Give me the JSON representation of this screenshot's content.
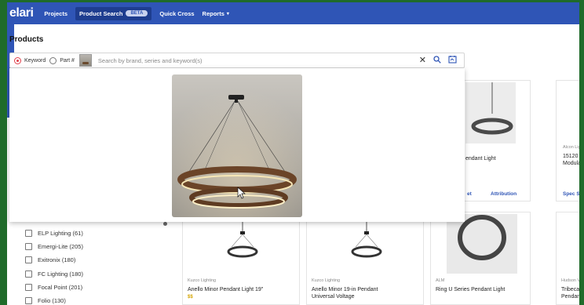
{
  "nav": {
    "logo": "elari",
    "items": [
      {
        "label": "Projects"
      },
      {
        "label": "Product Search",
        "badge": "BETA",
        "active": true
      },
      {
        "label": "Quick Cross"
      },
      {
        "label": "Reports",
        "caret": "▾"
      }
    ]
  },
  "page": {
    "title": "Products"
  },
  "search": {
    "mode_keyword": "Keyword",
    "mode_part": "Part #",
    "placeholder": "Search by brand, series and keyword(s)",
    "selected_mode": "Keyword"
  },
  "filters": [
    {
      "label": "ELP Lighting (61)"
    },
    {
      "label": "Emergi-Lite (205)"
    },
    {
      "label": "Exitronix (180)"
    },
    {
      "label": "FC Lighting (180)"
    },
    {
      "label": "Focal Point (201)"
    },
    {
      "label": "Folio (130)"
    }
  ],
  "top_cards": [
    {
      "name": "endant Light",
      "spec": "et",
      "attribution": "Attribution"
    },
    {
      "brand": "Alcon Lig",
      "name_line1": "15120 R",
      "name_line2": "Modular",
      "spec": "Spec S"
    }
  ],
  "products": [
    {
      "brand": "Kuzco Lighting",
      "name": "Anello Minor Pendant Light 19\"",
      "price": "$$"
    },
    {
      "brand": "Kuzco Lighting",
      "name_line1": "Anello Minor 19-in Pendant",
      "name_line2": "Universal Voltage"
    },
    {
      "brand": "ALM",
      "name": "Ring U Series Pendant Light"
    },
    {
      "brand": "Hudson V",
      "name_line1": "Tribeca",
      "name_line2": "Pendant"
    }
  ],
  "colors": {
    "primary": "#2f55b6",
    "accent_red": "#e0404a",
    "frame_green": "#1f6b2a"
  }
}
